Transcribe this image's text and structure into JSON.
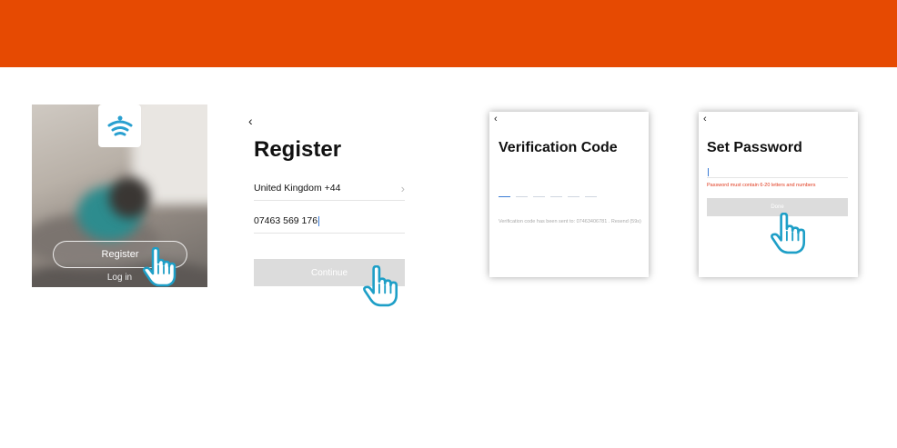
{
  "colors": {
    "brand_bar": "#e64a02",
    "hand_outline": "#1e9fc7",
    "accent_blue": "#3a7bd5",
    "error_red": "#e03a1e"
  },
  "welcome": {
    "register_label": "Register",
    "login_label": "Log in",
    "logo_icon": "wifi-icon"
  },
  "register": {
    "back_icon": "chevron-left-icon",
    "title": "Register",
    "country": "United Kingdom +44",
    "phone": "07463 569 176",
    "continue_label": "Continue"
  },
  "verification": {
    "title": "Verification Code",
    "code_slots": 6,
    "info": "Verification code has been sent to: 07463406781 . Resend (59s)"
  },
  "set_password": {
    "title": "Set Password",
    "error": "Password must contain 6-20 letters and numbers",
    "done_label": "Done"
  },
  "icons": [
    "chevron-left-icon",
    "chevron-right-icon",
    "wifi-icon",
    "pointing-hand-icon"
  ]
}
